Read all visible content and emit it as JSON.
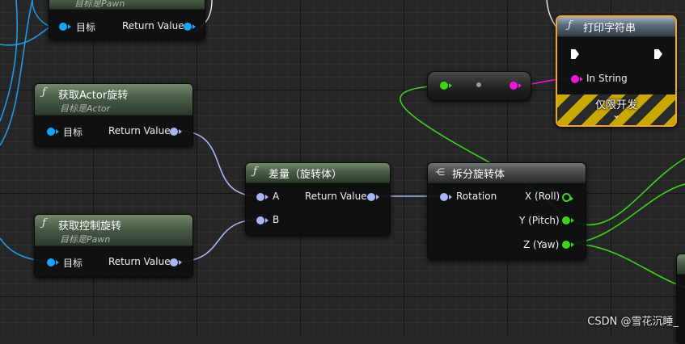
{
  "nodes": {
    "top_partial": {
      "subtitle": "目标是Pawn",
      "target": "目标",
      "return_value": "Return Value"
    },
    "get_actor_rotation": {
      "fn": "ƒ",
      "title": "获取Actor旋转",
      "subtitle": "目标是Actor",
      "target": "目标",
      "return_value": "Return Value"
    },
    "get_control_rotation": {
      "fn": "ƒ",
      "title": "获取控制旋转",
      "subtitle": "目标是Pawn",
      "target": "目标",
      "return_value": "Return Value"
    },
    "delta_rotator": {
      "fn": "ƒ",
      "title": "差量（旋转体）",
      "a": "A",
      "b": "B",
      "return_value": "Return Value"
    },
    "break_rotator": {
      "title": "拆分旋转体",
      "rotation": "Rotation",
      "x": "X (Roll)",
      "y": "Y (Pitch)",
      "z": "Z (Yaw)"
    },
    "print_string": {
      "fn": "ƒ",
      "title": "打印字符串",
      "in_string": "In String",
      "dev_only": "仅限开发",
      "expand": "⌄"
    }
  },
  "watermark": "CSDN @雪花沉睡_",
  "colors": {
    "object_pin": "#19a5f5",
    "rotator_pin": "#a9b4f2",
    "float_pin": "#3ed11f",
    "string_pin": "#ee16d8",
    "selection": "#f3a42a",
    "grid": "#262626"
  }
}
